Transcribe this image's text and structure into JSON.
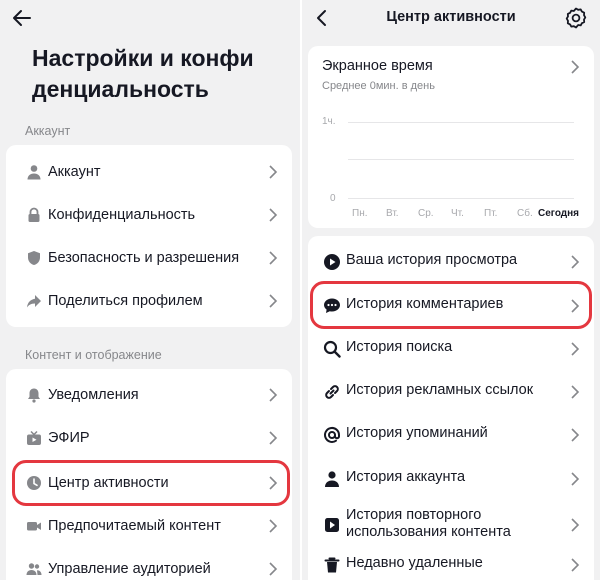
{
  "left": {
    "title": "Настройки и конфи денциальность",
    "account_section": "Аккаунт",
    "account_items": [
      {
        "label": "Аккаунт",
        "icon": "person-icon"
      },
      {
        "label": "Конфиденциальность",
        "icon": "lock-icon"
      },
      {
        "label": "Безопасность и разрешения",
        "icon": "shield-icon"
      },
      {
        "label": "Поделиться профилем",
        "icon": "share-icon"
      }
    ],
    "content_section": "Контент и отображение",
    "content_items": [
      {
        "label": "Уведомления",
        "icon": "bell-icon"
      },
      {
        "label": "ЭФИР",
        "icon": "live-tv-icon"
      },
      {
        "label": "Центр активности",
        "icon": "clock-icon",
        "highlighted": true
      },
      {
        "label": "Предпочитаемый контент",
        "icon": "video-camera-icon"
      },
      {
        "label": "Управление аудиторией",
        "icon": "people-icon"
      }
    ]
  },
  "right": {
    "header_title": "Центр активности",
    "screen_time": {
      "title": "Экранное время",
      "subtitle": "Среднее 0мин. в день",
      "y_ticks": [
        "1ч.",
        "0"
      ],
      "days": [
        "Пн.",
        "Вт.",
        "Ср.",
        "Чт.",
        "Пт.",
        "Сб.",
        "Сегодня"
      ]
    },
    "items": [
      {
        "label": "Ваша история просмотра",
        "icon": "play-circle-icon"
      },
      {
        "label": "История комментариев",
        "icon": "comment-icon",
        "highlighted": true
      },
      {
        "label": "История поиска",
        "icon": "search-icon"
      },
      {
        "label": "История рекламных ссылок",
        "icon": "link-icon"
      },
      {
        "label": "История упоминаний",
        "icon": "at-icon"
      },
      {
        "label": "История аккаунта",
        "icon": "person-icon"
      },
      {
        "label": "История повторного использования контента",
        "icon": "repost-icon"
      },
      {
        "label": "Недавно удаленные",
        "icon": "trash-icon"
      }
    ]
  },
  "colors": {
    "highlight": "#e4373f",
    "background": "#f1f1f2",
    "card": "#ffffff",
    "text": "#161823",
    "muted": "#86878b"
  }
}
